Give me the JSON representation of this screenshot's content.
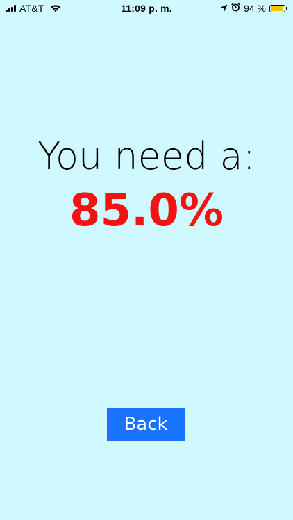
{
  "status_bar": {
    "carrier": "AT&T",
    "time": "11:09 p. m.",
    "battery_percent": "94 %",
    "battery_level": 0.94,
    "battery_color": "#f8c200",
    "icons": [
      "signal-icon",
      "wifi-icon",
      "location-arrow-icon",
      "alarm-clock-icon",
      "battery-icon"
    ]
  },
  "main": {
    "headline": "You need a:",
    "result": "85.0%",
    "result_color": "#f31313"
  },
  "actions": {
    "back_label": "Back",
    "back_color": "#1a73ff"
  },
  "colors": {
    "background": "#cff8ff"
  }
}
